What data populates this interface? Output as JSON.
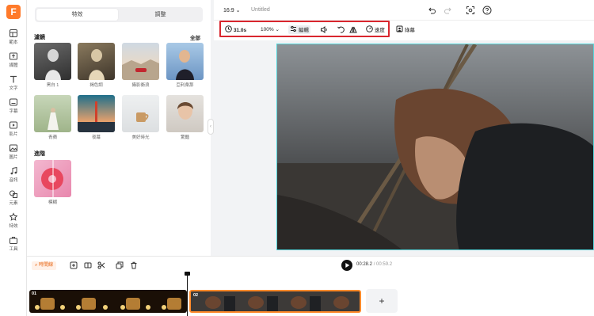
{
  "app": {
    "logo_letter": "F",
    "brand_color": "#ff7a2a"
  },
  "rail": {
    "items": [
      {
        "label": "範本",
        "icon": "template-icon"
      },
      {
        "label": "媒體",
        "icon": "media-upload-icon"
      },
      {
        "label": "文字",
        "icon": "text-icon"
      },
      {
        "label": "字幕",
        "icon": "subtitle-icon"
      },
      {
        "label": "影片",
        "icon": "video-icon"
      },
      {
        "label": "圖片",
        "icon": "image-icon"
      },
      {
        "label": "音訊",
        "icon": "audio-icon"
      },
      {
        "label": "元素",
        "icon": "elements-icon"
      },
      {
        "label": "特效",
        "icon": "effects-icon"
      },
      {
        "label": "工具",
        "icon": "tools-icon"
      }
    ]
  },
  "panel": {
    "tabs": [
      "特效",
      "調整"
    ],
    "filters_title": "濾鏡",
    "all_label": "全部",
    "filters": [
      "黑白 1",
      "褐色調",
      "攝影衝浪",
      "亞利桑那",
      "青蘋",
      "夜幕",
      "美好時光",
      "驚豔"
    ],
    "advanced_title": "進階",
    "advanced": [
      "模糊"
    ]
  },
  "topbar": {
    "ratio": "16:9",
    "title": "Untitled"
  },
  "toolbar": {
    "duration": "31.0s",
    "zoom": "100%",
    "edit_label": "編輯",
    "speed_label": "速度",
    "matting_label": "綠幕"
  },
  "timeline": {
    "chip_label": "時間線",
    "current_time": "00:28.2",
    "total_time": "00:59.2",
    "clips": [
      {
        "number": "01"
      },
      {
        "number": "02"
      }
    ],
    "add_label": "+"
  },
  "colors": {
    "accent": "#ff7a2a",
    "highlight_box": "#d9262e",
    "selection": "#55d6db",
    "clip_selected_border": "#ff8a2a"
  }
}
